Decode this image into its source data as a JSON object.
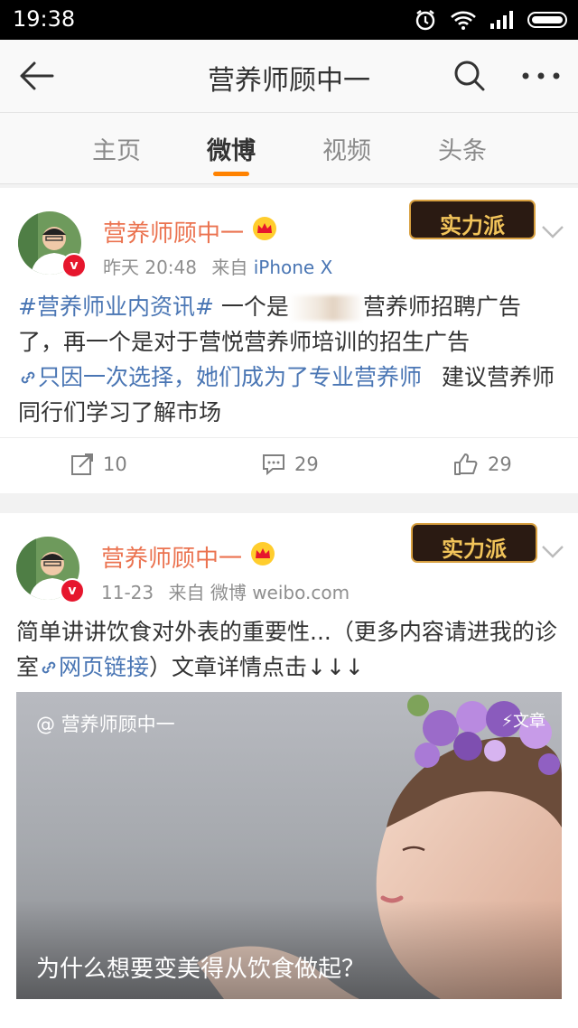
{
  "status_bar": {
    "time": "19:38"
  },
  "nav": {
    "title": "营养师顾中一"
  },
  "tabs": [
    {
      "label": "主页"
    },
    {
      "label": "微博"
    },
    {
      "label": "视频"
    },
    {
      "label": "头条"
    }
  ],
  "colors": {
    "accent": "#ff8200",
    "author": "#eb7350",
    "link": "#4a76b4",
    "vip_badge": "#e6162d"
  },
  "posts": [
    {
      "author": "营养师顾中一",
      "time": "昨天 20:48",
      "source_prefix": "来自",
      "source": "iPhone X",
      "text": {
        "tag": "#营养师业内资讯#",
        "part1": "一个是",
        "part2": "营养师招聘广告了，再一个是对于营悦营养师培训的招生广告",
        "link": "只因一次选择，她们成为了专业营养师",
        "part3": "建议营养师同行们学习了解市场"
      },
      "reposts": "10",
      "comments": "29",
      "likes": "29"
    },
    {
      "author": "营养师顾中一",
      "time": "11-23",
      "source_prefix": "来自",
      "source": "微博 weibo.com",
      "text": {
        "part1": "简单讲讲饮食对外表的重要性...（更多内容请进我的诊室",
        "link": "网页链接",
        "part2": "）文章详情点击↓↓↓"
      },
      "article": {
        "user": "@ 营养师顾中一",
        "badge": "文章",
        "title": "为什么想要变美得从饮食做起？"
      }
    }
  ],
  "sticker_text": "实力派"
}
